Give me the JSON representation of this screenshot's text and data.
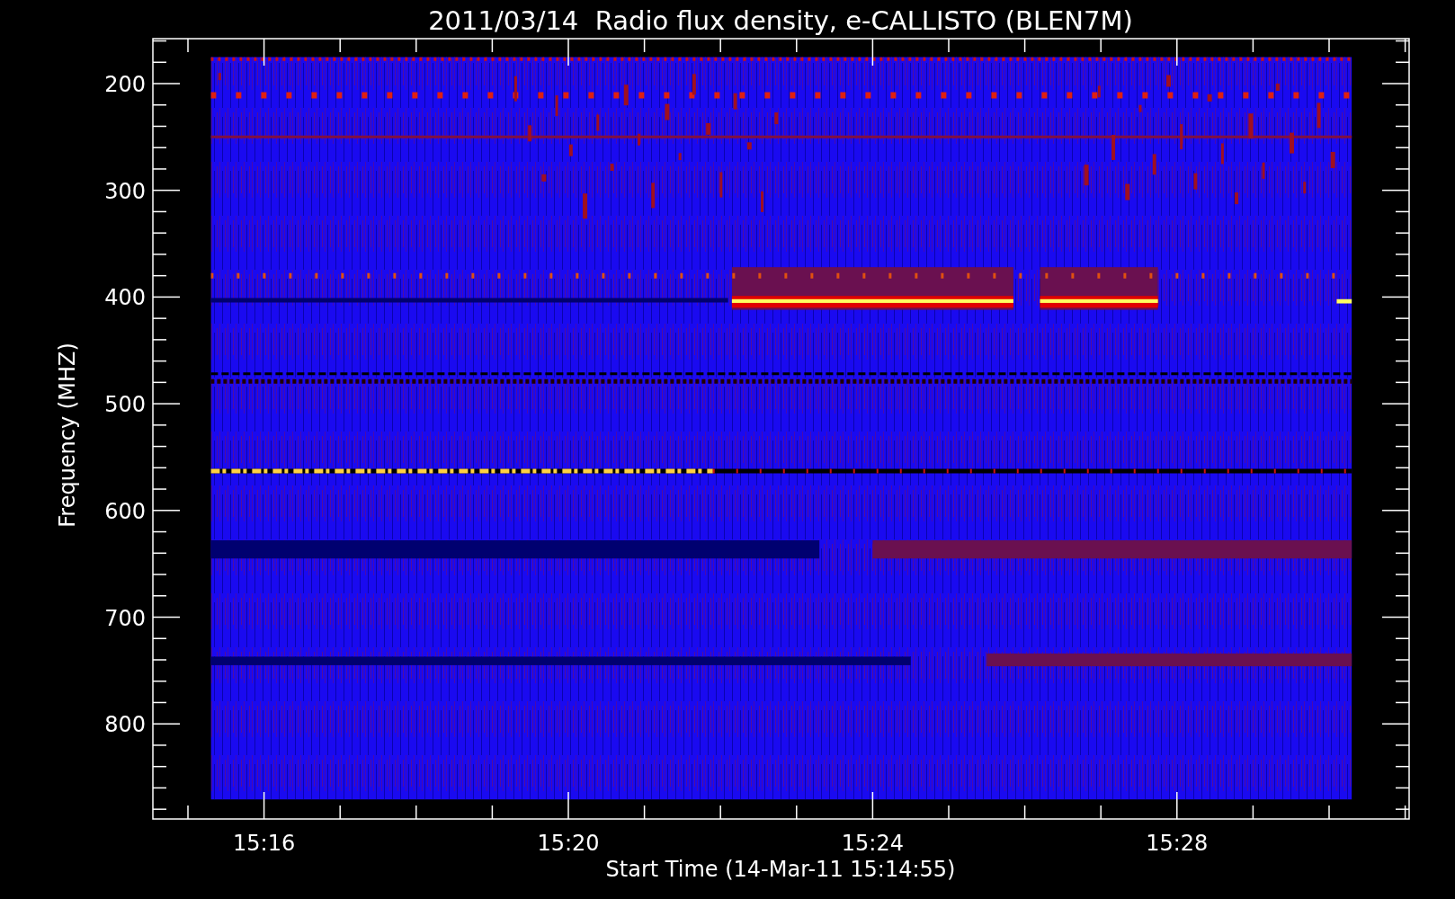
{
  "title": "2011/03/14  Radio flux density, e-CALLISTO (BLEN7M)",
  "y_axis": {
    "label": "Frequency (MHZ)",
    "ticks": [
      "200",
      "300",
      "400",
      "500",
      "600",
      "700",
      "800"
    ]
  },
  "x_axis": {
    "label": "Start Time (14-Mar-11 15:14:55)",
    "ticks": [
      "15:16",
      "15:20",
      "15:24",
      "15:28"
    ]
  }
}
